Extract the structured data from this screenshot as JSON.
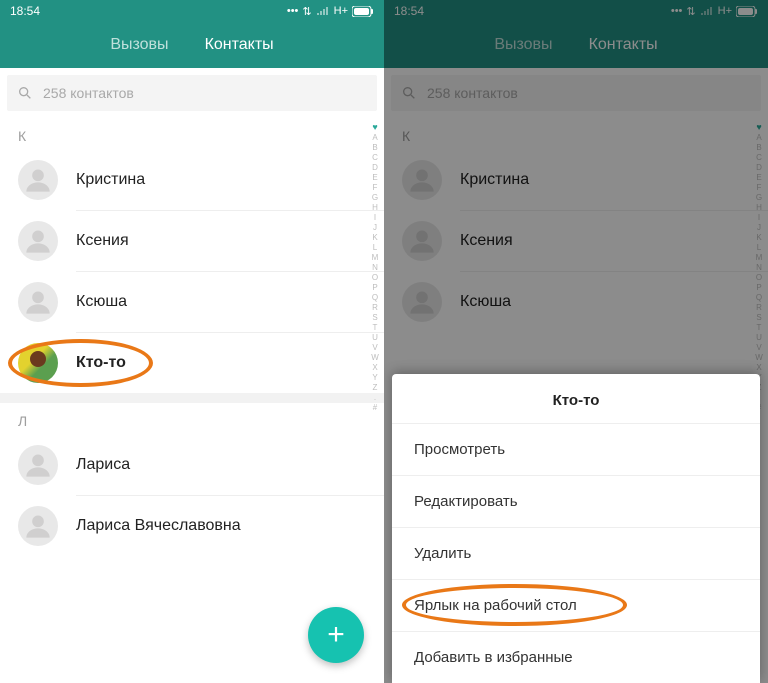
{
  "status": {
    "time": "18:54",
    "net": "H+"
  },
  "tabs": {
    "calls": "Вызовы",
    "contacts": "Контакты"
  },
  "search": {
    "placeholder": "258 контактов"
  },
  "sections": {
    "k": "К",
    "l": "Л"
  },
  "contacts_k": [
    {
      "name": "Кристина"
    },
    {
      "name": "Ксения"
    },
    {
      "name": "Ксюша"
    },
    {
      "name": "Кто-то"
    }
  ],
  "contacts_l": [
    {
      "name": "Лариса"
    },
    {
      "name": "Лариса Вячеславовна"
    }
  ],
  "alpha_index": [
    "A",
    "B",
    "C",
    "D",
    "E",
    "F",
    "G",
    "H",
    "I",
    "J",
    "K",
    "L",
    "M",
    "N",
    "O",
    "P",
    "Q",
    "R",
    "S",
    "T",
    "U",
    "V",
    "W",
    "X",
    "Y",
    "Z",
    ".",
    "#"
  ],
  "fab": "+",
  "menu": {
    "title": "Кто-то",
    "items": [
      "Просмотреть",
      "Редактировать",
      "Удалить",
      "Ярлык на рабочий стол",
      "Добавить в избранные"
    ]
  },
  "highlight": {
    "left_contact_index": 3,
    "right_menu_index": 3
  }
}
